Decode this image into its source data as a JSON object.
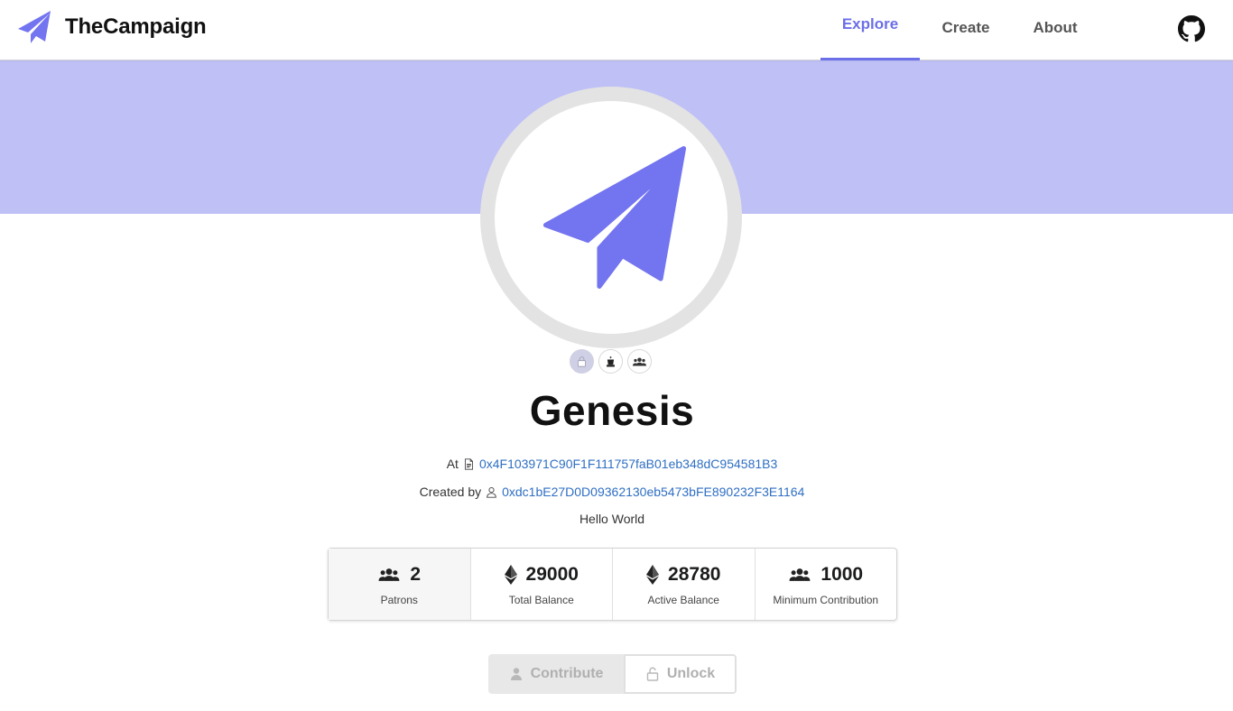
{
  "brand": {
    "name": "TheCampaign",
    "accent": "#7374f0"
  },
  "nav": {
    "explore": "Explore",
    "create": "Create",
    "about": "About"
  },
  "campaign": {
    "title": "Genesis",
    "at_label": "At",
    "address": "0x4F103971C90F1F111757faB01eb348dC954581B3",
    "created_by_label": "Created by",
    "creator": "0xdc1bE27D0D09362130eb5473bFE890232F3E1164",
    "description": "Hello World"
  },
  "badges": [
    "lock-icon",
    "chess-king-icon",
    "users-icon"
  ],
  "stats": [
    {
      "icon": "users-icon",
      "value": "2",
      "label": "Patrons"
    },
    {
      "icon": "ethereum-icon",
      "value": "29000",
      "label": "Total Balance"
    },
    {
      "icon": "ethereum-icon",
      "value": "28780",
      "label": "Active Balance"
    },
    {
      "icon": "users-icon",
      "value": "1000",
      "label": "Minimum Contribution"
    }
  ],
  "actions": {
    "contribute": "Contribute",
    "unlock": "Unlock"
  },
  "colors": {
    "hero": "#bfc0f6",
    "link": "#2f6fc4",
    "active_nav": "#6b6fe8"
  }
}
